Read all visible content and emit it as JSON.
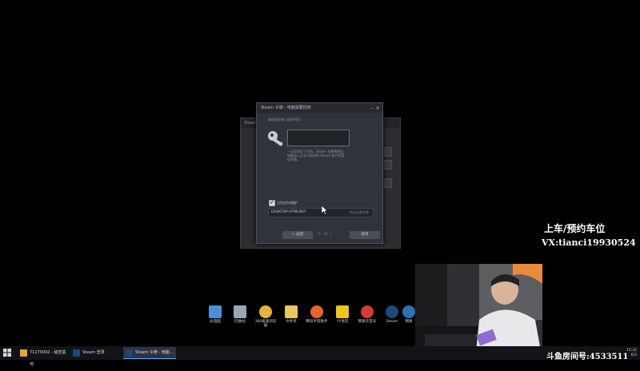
{
  "background_window": {
    "title": "Steam 登"
  },
  "guard_dialog": {
    "title": "Steam 令牌 - 电脑需要授权",
    "prompt": "请在此处输入您的代码：",
    "code_value": "",
    "explain_line1": "一旦您验证了代码，Steam 令牌将把这",
    "explain_line2": "电脑加入至名为您的的 Steam 帐户的受",
    "explain_line3": "信列表。",
    "remember_label": "记住这台电脑？",
    "remember_checked": true,
    "computer_name": "DESKTOP-HTMLB07",
    "name_hint": "所以记录名称",
    "back_label": "< 返回",
    "next_label": "下一步 >",
    "cancel_label": "取消",
    "minimize_glyph": "–",
    "close_glyph": "×"
  },
  "desktop_icons": [
    {
      "label": "此电脑",
      "icon": "computer-icon",
      "color": "#4a90d9"
    },
    {
      "label": "回收站",
      "icon": "recycle-bin-icon",
      "color": "#9aa7b5"
    },
    {
      "label": "360极速浏览器",
      "icon": "browser-360-icon",
      "color": "#e8b33a"
    },
    {
      "label": "文件夹",
      "icon": "folder-icon",
      "color": "#e9c660"
    },
    {
      "label": "腾讯手游助手",
      "icon": "tencent-game-helper-icon",
      "color": "#e8652b"
    },
    {
      "label": "YY语音",
      "icon": "yy-voice-icon",
      "color": "#f0c419"
    },
    {
      "label": "网易云音乐",
      "icon": "netease-music-icon",
      "color": "#d43c33"
    },
    {
      "label": "Steam",
      "icon": "steam-icon",
      "color": "#1b4a7a"
    },
    {
      "label": "网易",
      "icon": "netease-icon",
      "color": "#2f6fb3"
    }
  ],
  "overlay": {
    "line1": "上车/预约车位",
    "line2": "VX:tianci19930524",
    "room": "斗鱼房间号:4533511"
  },
  "taskbar": {
    "items": [
      {
        "label": "71270092 - 秘密基地",
        "icon": "qq-group-icon",
        "color": "#e6a23c"
      },
      {
        "label": "Steam 登录",
        "icon": "steam-icon",
        "color": "#1b4a7a"
      },
      {
        "label": "Steam 令牌 - 电脑...",
        "icon": "steam-icon",
        "color": "#1b4a7a"
      }
    ],
    "clock_time": "15:32",
    "clock_date": "6/3"
  },
  "colors": {
    "dialog_bg": "#30343a",
    "taskbar_bg": "#101318",
    "overlay_text": "#ffffff"
  }
}
